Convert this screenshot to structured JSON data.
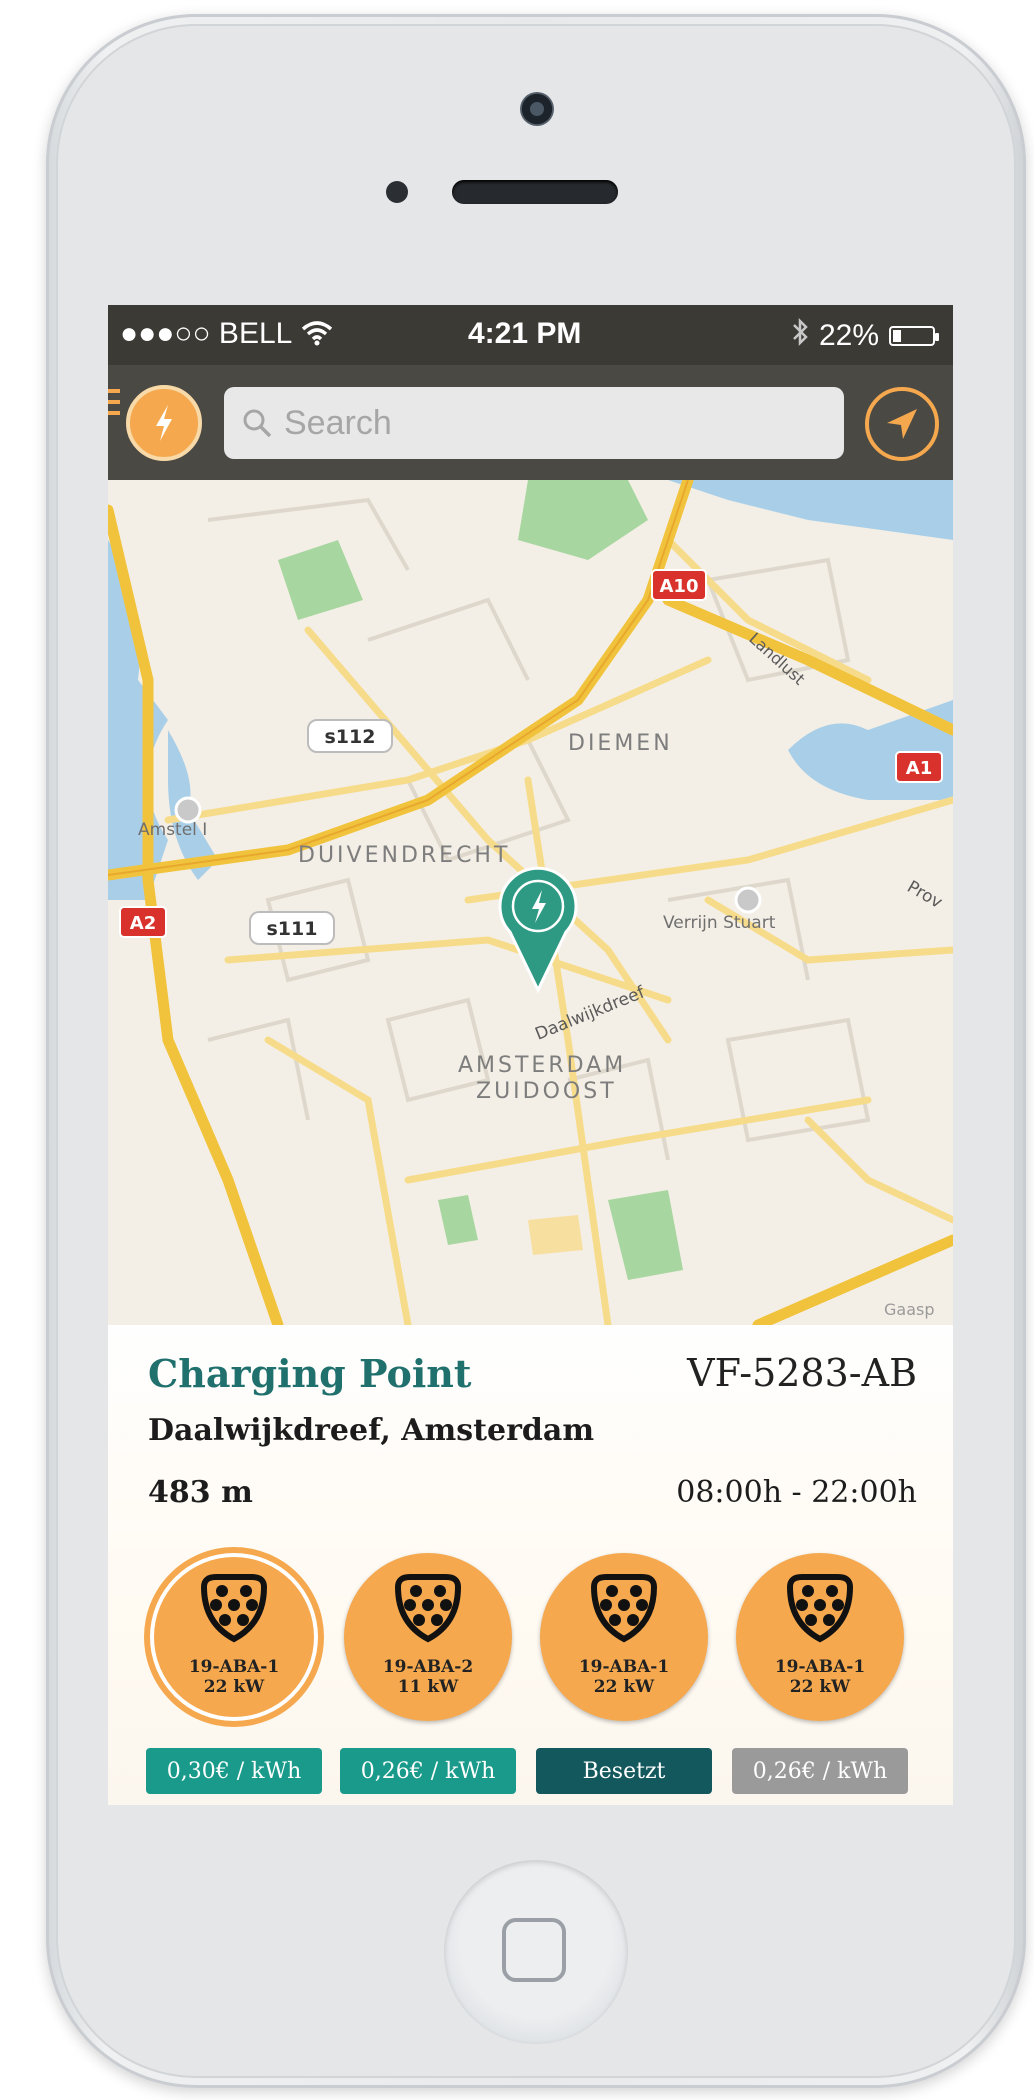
{
  "status_bar": {
    "carrier": "●●●○○ BELL",
    "time": "4:21 PM",
    "battery": "22%",
    "battery_level": 0.22
  },
  "search": {
    "placeholder": "Search"
  },
  "map": {
    "labels": {
      "diemen": "DIEMEN",
      "duivendrecht": "DUIVENDRECHT",
      "amsterdam": "AMSTERDAM",
      "zuidoost": "ZUIDOOST",
      "amstel": "Amstel I",
      "verrijn": "Verrijn Stuart",
      "daalwijkdreef": "Daalwijkdreef",
      "landlust": "Landlust",
      "prov": "Prov",
      "gaasp": "Gaasp"
    },
    "shields": {
      "a10": "A10",
      "a1": "A1",
      "a2": "A2",
      "s112": "s112",
      "s111": "s111"
    }
  },
  "charging_point": {
    "title": "Charging Point",
    "id": "VF-5283-AB",
    "address": "Daalwijkdreef, Amsterdam",
    "distance": "483 m",
    "hours": "08:00h - 22:00h"
  },
  "connectors": [
    {
      "code": "19-ABA-1",
      "power": "22 kW",
      "price": "0,30€ / kWh",
      "status_color": "#1a9a8a"
    },
    {
      "code": "19-ABA-2",
      "power": "11 kW",
      "price": "0,26€ / kWh",
      "status_color": "#1a9a8a"
    },
    {
      "code": "19-ABA-1",
      "power": "22 kW",
      "price": "Besetzt",
      "status_color": "#13585c"
    },
    {
      "code": "19-ABA-1",
      "power": "22 kW",
      "price": "0,26€ / kWh",
      "status_color": "#9a9a9a"
    }
  ],
  "colors": {
    "accent": "#f5a84e",
    "teal": "#20706e",
    "navbar": "#4a4944"
  },
  "icons": {
    "menu": "bolt-icon",
    "locate": "location-arrow-icon",
    "search": "search-icon",
    "pin": "map-pin-bolt-icon",
    "plug": "type2-plug-icon"
  }
}
